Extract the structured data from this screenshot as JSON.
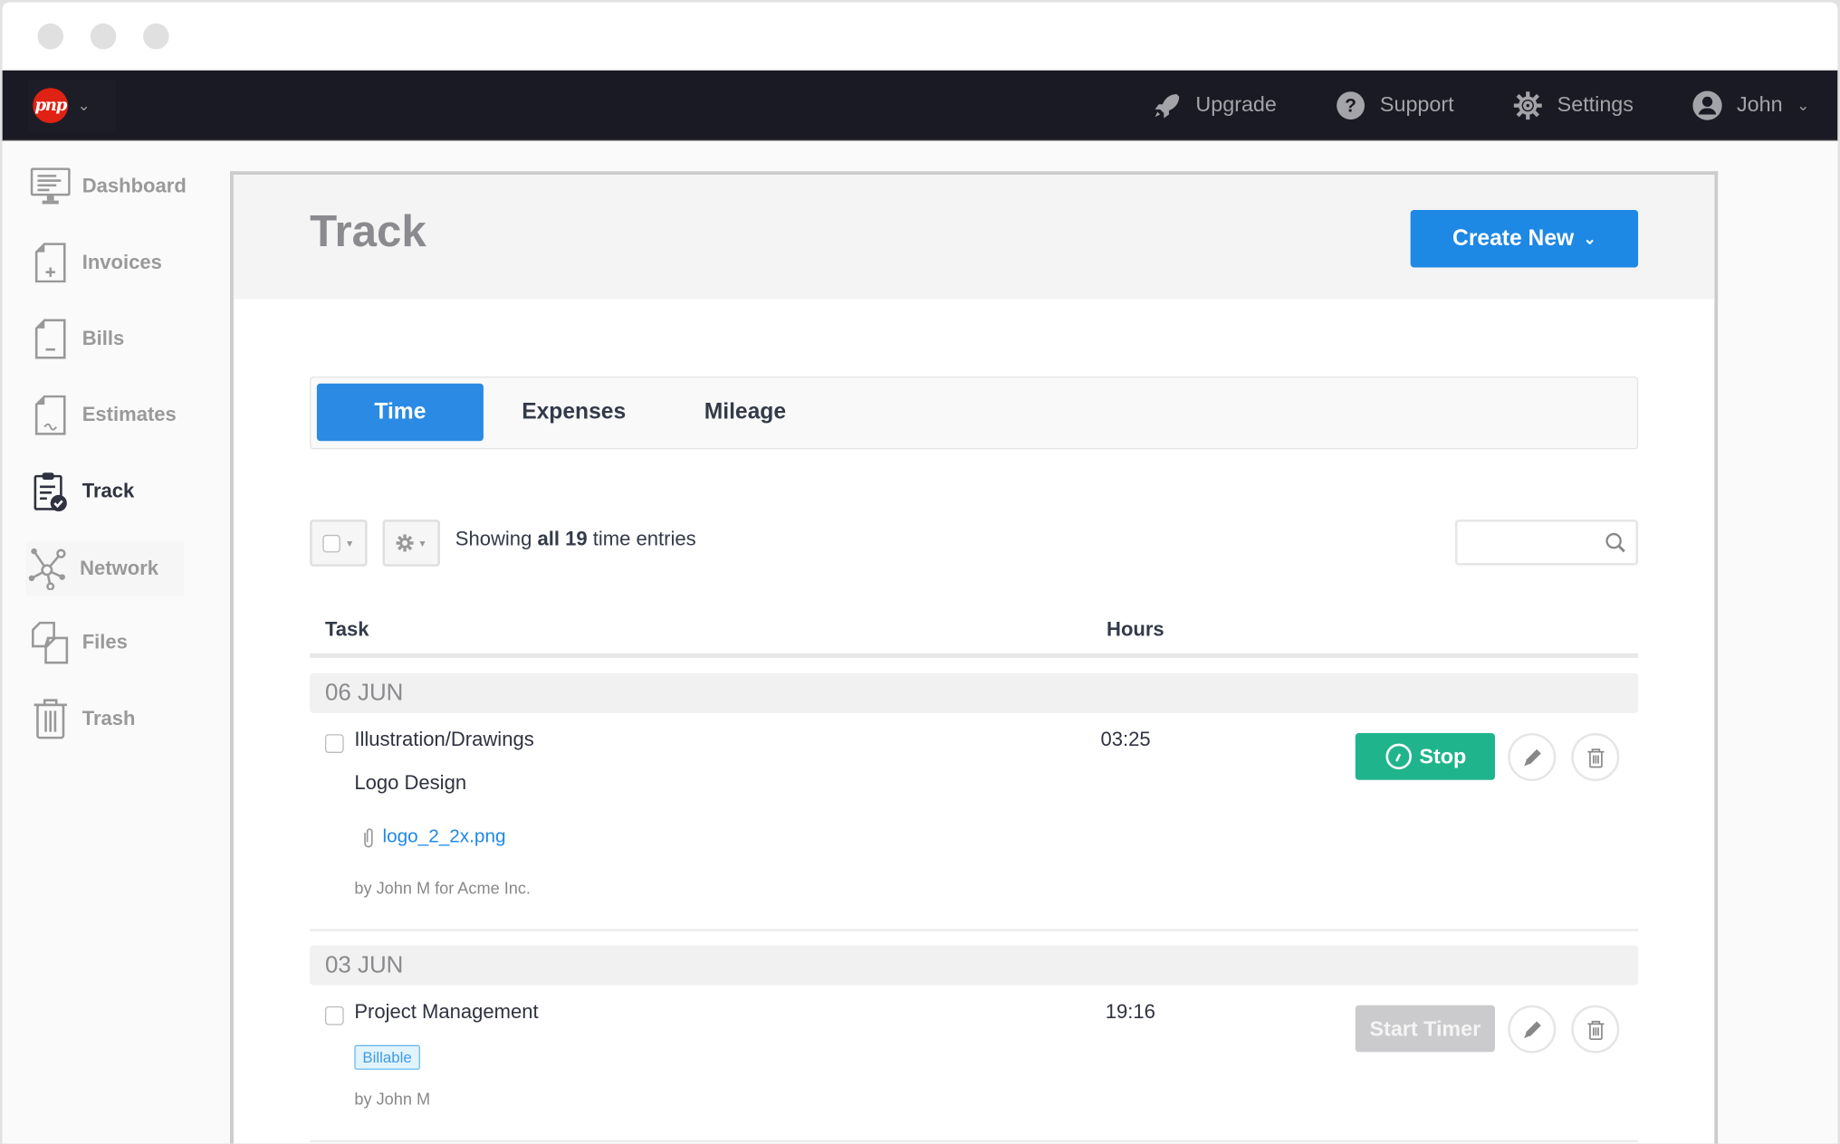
{
  "window": {
    "controls": [
      "close",
      "minimize",
      "maximize"
    ]
  },
  "topnav": {
    "logo_text": "pnp",
    "links": [
      {
        "label": "Upgrade",
        "icon": "rocket-icon"
      },
      {
        "label": "Support",
        "icon": "question-icon"
      },
      {
        "label": "Settings",
        "icon": "gear-icon"
      },
      {
        "label": "John",
        "icon": "user-icon"
      }
    ]
  },
  "sidebar": {
    "items": [
      {
        "label": "Dashboard",
        "icon": "monitor-icon"
      },
      {
        "label": "Invoices",
        "icon": "invoice-icon"
      },
      {
        "label": "Bills",
        "icon": "bill-icon"
      },
      {
        "label": "Estimates",
        "icon": "estimate-icon"
      },
      {
        "label": "Track",
        "icon": "clipboard-check-icon",
        "active": true
      },
      {
        "label": "Network",
        "icon": "network-icon"
      },
      {
        "label": "Files",
        "icon": "files-icon"
      },
      {
        "label": "Trash",
        "icon": "trash-icon"
      }
    ]
  },
  "page": {
    "title": "Track",
    "create_button": "Create New",
    "tabs": [
      {
        "label": "Time",
        "active": true
      },
      {
        "label": "Expenses"
      },
      {
        "label": "Mileage"
      }
    ]
  },
  "toolbar": {
    "showing_prefix": "Showing",
    "showing_all": "all",
    "showing_count": "19",
    "showing_suffix": "time entries",
    "search_placeholder": ""
  },
  "table": {
    "columns": [
      "Task",
      "Hours"
    ],
    "groups": [
      {
        "date": "06 JUN",
        "entries": [
          {
            "task": "Illustration/Drawings",
            "hours": "03:25",
            "description": "Logo Design",
            "attachment": "logo_2_2x.png",
            "meta": "by John M for Acme Inc.",
            "timer_button": "Stop"
          }
        ]
      },
      {
        "date": "03 JUN",
        "entries": [
          {
            "task": "Project Management",
            "hours": "19:16",
            "badge": "Billable",
            "meta": "by John M",
            "timer_button": "Start Timer"
          }
        ]
      }
    ]
  },
  "colors": {
    "primary": "#1e88e5",
    "success": "#20b48c",
    "nav_bg": "#1a1a24",
    "logo": "#df2213",
    "disabled": "#cbcbcd"
  }
}
